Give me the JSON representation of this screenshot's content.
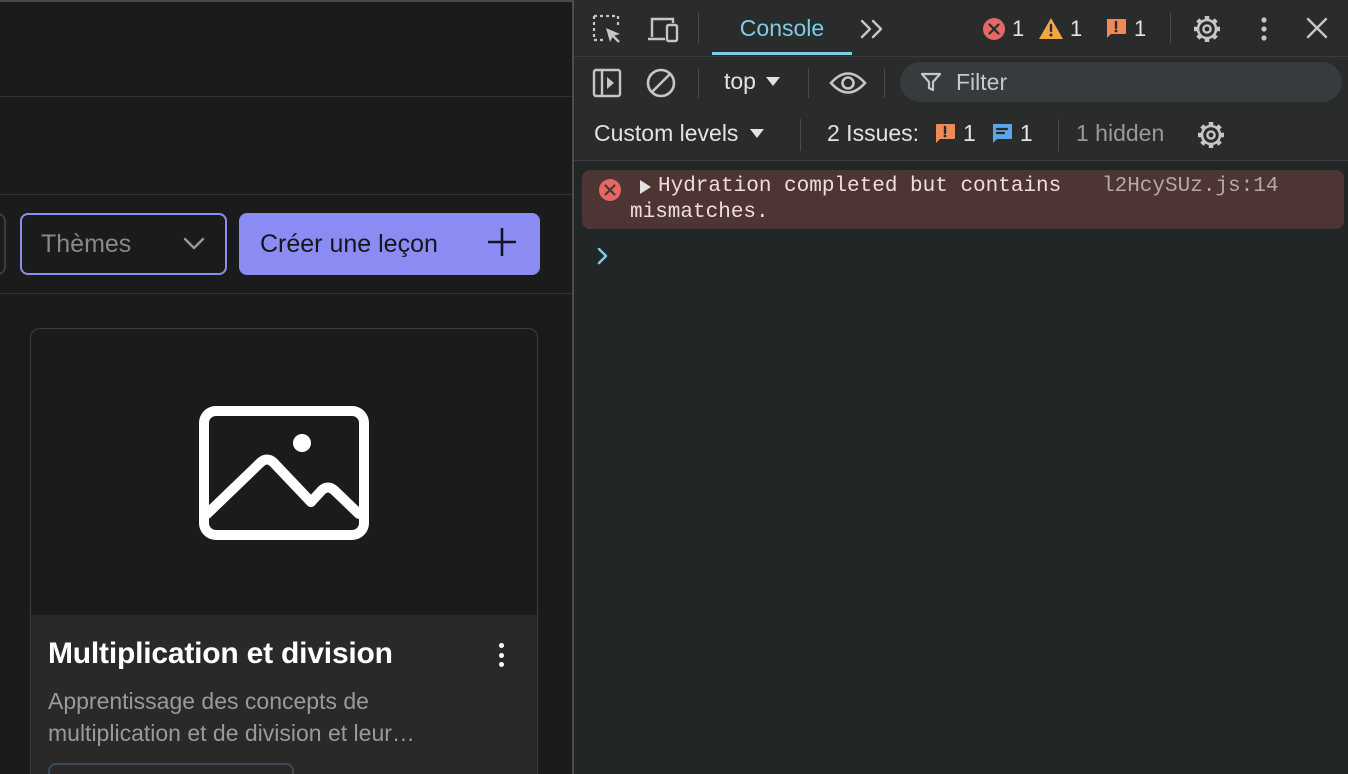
{
  "app": {
    "themes_select": {
      "placeholder": "Thèmes"
    },
    "create_button": {
      "label": "Créer une leçon"
    },
    "lesson_card": {
      "title": "Multiplication et division",
      "description_line1": "Apprentissage des concepts de",
      "description_line2": "multiplication et de division et leur…"
    }
  },
  "devtools": {
    "tabs": {
      "console": "Console"
    },
    "counts": {
      "errors": "1",
      "warnings": "1",
      "issues": "1"
    },
    "context": {
      "selected": "top"
    },
    "filter": {
      "placeholder": "Filter"
    },
    "levels": {
      "selected": "Custom levels"
    },
    "issues_summary": {
      "label": "2 Issues:",
      "breaking": "1",
      "info": "1"
    },
    "hidden": "1 hidden",
    "messages": [
      {
        "level": "error",
        "line1": "Hydration completed but contains",
        "line2": "mismatches.",
        "source": "l2HcySUz.js:14"
      }
    ]
  },
  "colors": {
    "accent": "#8a8cf4",
    "console_accent": "#7fcbe6",
    "error": "#e46962",
    "warning": "#f1a545",
    "issue": "#ef8a55",
    "info_issue": "#5ba6e8"
  }
}
